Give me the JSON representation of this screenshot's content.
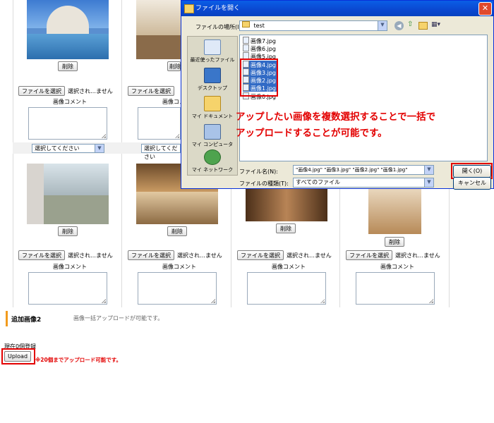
{
  "grid": {
    "delete_label": "削除",
    "choose_file_label": "ファイルを選択",
    "no_file_label": "選択され…ません",
    "comment_label": "画像コメント",
    "select_placeholder": "選択してください"
  },
  "section": {
    "title": "追加画像2",
    "description": "画像一括アップロードが可能です。",
    "current_count": "現在0個登録",
    "upload_label": "Upload",
    "upload_note": "※20個までアップロード可能です。"
  },
  "dialog": {
    "title": "ファイルを開く",
    "location_label": "ファイルの場所(I):",
    "location_value": "test",
    "places": [
      {
        "label": "最近使ったファイル",
        "icon": "recent-icon"
      },
      {
        "label": "デスクトップ",
        "icon": "desktop-icon"
      },
      {
        "label": "マイ ドキュメント",
        "icon": "my-documents-icon"
      },
      {
        "label": "マイ コンピュータ",
        "icon": "my-computer-icon"
      },
      {
        "label": "マイ ネットワーク",
        "icon": "my-network-icon"
      }
    ],
    "files": [
      {
        "name": "画像7.jpg",
        "selected": false
      },
      {
        "name": "画像6.jpg",
        "selected": false
      },
      {
        "name": "画像5.jpg",
        "selected": false
      },
      {
        "name": "画像4.jpg",
        "selected": true
      },
      {
        "name": "画像3.jpg",
        "selected": true
      },
      {
        "name": "画像2.jpg",
        "selected": true
      },
      {
        "name": "画像1.jpg",
        "selected": true
      },
      {
        "name": "画像0.jpg",
        "selected": false
      }
    ],
    "filename_label": "ファイル名(N):",
    "filename_value": "\"画像4.jpg\" \"画像3.jpg\" \"画像2.jpg\" \"画像1.jpg\"",
    "filetype_label": "ファイルの種類(T):",
    "filetype_value": "すべてのファイル",
    "open_label": "開く(O)",
    "cancel_label": "キャンセル"
  },
  "annotation": {
    "line1": "アップしたい画像を複数選択することで一括で",
    "line2": "アップロードすることが可能です。"
  },
  "colors": {
    "highlight": "#e30000",
    "selection": "#316ac5",
    "section_accent": "#f29b1d"
  }
}
